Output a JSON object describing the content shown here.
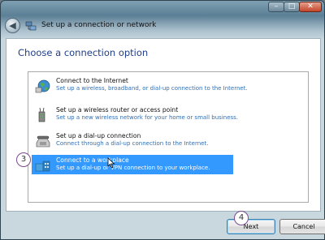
{
  "window": {
    "title": "Set up a connection or network",
    "minimize_glyph": "–",
    "maximize_glyph": "□",
    "close_glyph": "✕",
    "back_glyph": "◀"
  },
  "main": {
    "heading": "Choose a connection option",
    "options": [
      {
        "title": "Connect to the Internet",
        "description": "Set up a wireless, broadband, or dial-up connection to the Internet.",
        "icon": "globe-icon",
        "selected": false
      },
      {
        "title": "Set up a wireless router or access point",
        "description": "Set up a new wireless network for your home or small business.",
        "icon": "router-icon",
        "selected": false
      },
      {
        "title": "Set up a dial-up connection",
        "description": "Connect through a dial-up connection to the Internet.",
        "icon": "phone-icon",
        "selected": false
      },
      {
        "title": "Connect to a workplace",
        "description": "Set up a dial-up or VPN connection to your workplace.",
        "icon": "workplace-icon",
        "selected": true
      }
    ]
  },
  "markers": {
    "step3": "3",
    "step4": "4"
  },
  "footer": {
    "next_label": "Next",
    "cancel_label": "Cancel"
  },
  "colors": {
    "selection": "#3399ff",
    "heading": "#1f3e8a",
    "link_desc": "#2f6fb4"
  }
}
